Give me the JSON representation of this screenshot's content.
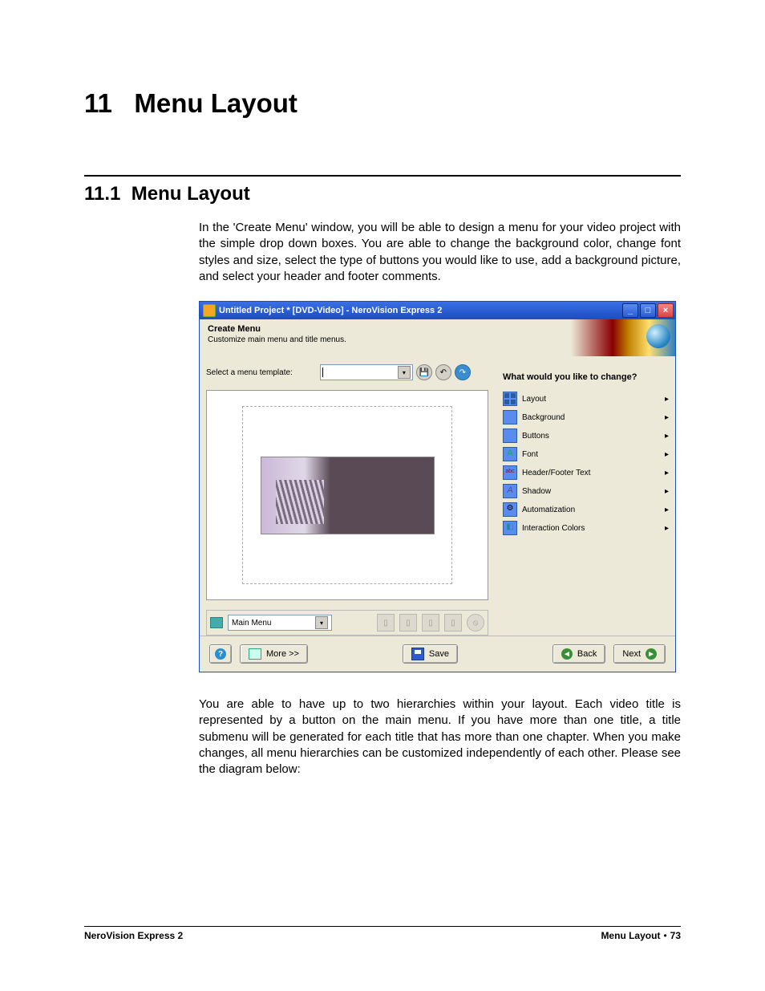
{
  "chapter": {
    "number": "11",
    "title": "Menu Layout"
  },
  "section": {
    "number": "11.1",
    "title": "Menu Layout"
  },
  "para1": "In the 'Create Menu' window, you will be able to design a menu for your video project with the simple drop down boxes. You are able to change the background color, change font styles and size, select the type of buttons you would like to use, add a background picture, and select your header and footer comments.",
  "para2": "You are able to have up to two hierarchies within your layout. Each video title is represented by a button on the main menu. If you have more than one title, a title submenu will be generated for each title that has more than one chapter. When you make changes, all menu hierarchies can be customized independently of each other. Please see the diagram below:",
  "win": {
    "title": "Untitled Project * [DVD-Video] - NeroVision Express 2",
    "header_title": "Create Menu",
    "header_sub": "Customize main menu and title menus.",
    "template_label": "Select a menu template:",
    "main_menu_label": "Main Menu",
    "right_heading": "What would you like to change?",
    "options": [
      {
        "label": "Layout",
        "iconClass": "ic-layout"
      },
      {
        "label": "Background",
        "iconClass": "ic-bg"
      },
      {
        "label": "Buttons",
        "iconClass": "ic-btn"
      },
      {
        "label": "Font",
        "iconClass": "ic-font"
      },
      {
        "label": "Header/Footer Text",
        "iconClass": "ic-hf"
      },
      {
        "label": "Shadow",
        "iconClass": "ic-sh"
      },
      {
        "label": "Automatization",
        "iconClass": "ic-auto"
      },
      {
        "label": "Interaction Colors",
        "iconClass": "ic-int"
      }
    ],
    "buttons": {
      "more": "More >>",
      "save": "Save",
      "back": "Back",
      "next": "Next"
    }
  },
  "footer": {
    "left": "NeroVision Express 2",
    "right_text": "Menu Layout",
    "page": "73"
  }
}
